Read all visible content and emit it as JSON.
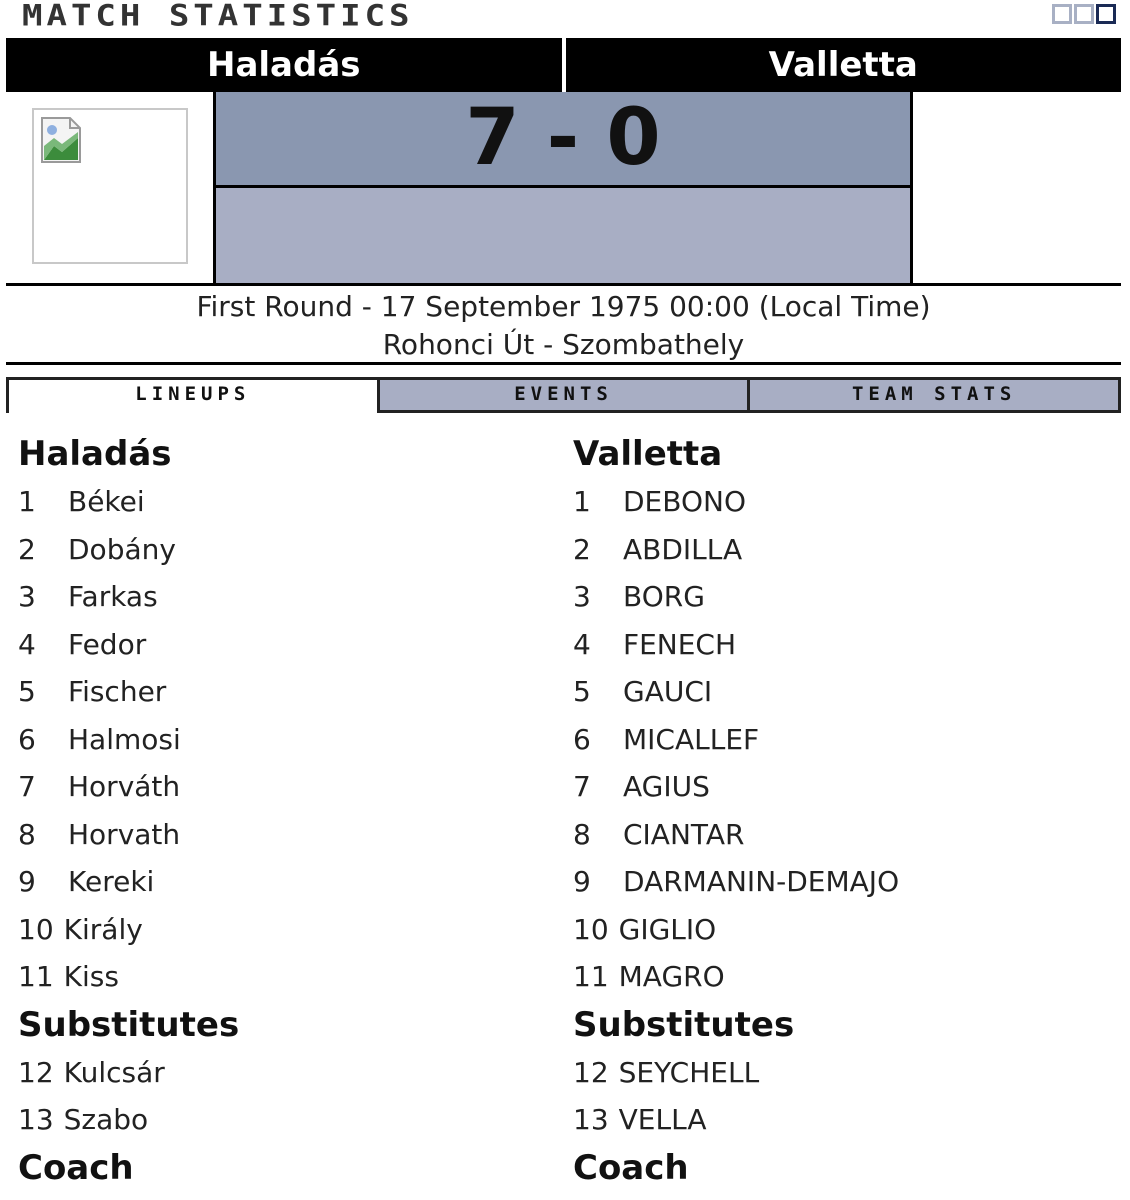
{
  "header": {
    "title": "MATCH STATISTICS"
  },
  "match": {
    "home_team": "Haladás",
    "away_team": "Valletta",
    "score": "7 - 0",
    "round_date": "First Round - 17 September 1975 00:00 (Local Time)",
    "venue": "Rohonci Út - Szombathely"
  },
  "tabs": [
    {
      "label": "LINEUPS",
      "active": true
    },
    {
      "label": "EVENTS",
      "active": false
    },
    {
      "label": "TEAM STATS",
      "active": false
    }
  ],
  "lineups": {
    "home": {
      "team": "Haladás",
      "players": [
        {
          "num": "1",
          "name": "Békei"
        },
        {
          "num": "2",
          "name": "Dobány"
        },
        {
          "num": "3",
          "name": "Farkas"
        },
        {
          "num": "4",
          "name": "Fedor"
        },
        {
          "num": "5",
          "name": "Fischer"
        },
        {
          "num": "6",
          "name": "Halmosi"
        },
        {
          "num": "7",
          "name": "Horváth"
        },
        {
          "num": "8",
          "name": "Horvath"
        },
        {
          "num": "9",
          "name": "Kereki"
        },
        {
          "num": "10",
          "name": "Király"
        },
        {
          "num": "11",
          "name": "Kiss"
        }
      ],
      "substitutes_label": "Substitutes",
      "substitutes": [
        {
          "num": "12",
          "name": "Kulcsár"
        },
        {
          "num": "13",
          "name": "Szabo"
        }
      ],
      "coach_label": "Coach"
    },
    "away": {
      "team": "Valletta",
      "players": [
        {
          "num": "1",
          "name": "DEBONO"
        },
        {
          "num": "2",
          "name": "ABDILLA"
        },
        {
          "num": "3",
          "name": "BORG"
        },
        {
          "num": "4",
          "name": "FENECH"
        },
        {
          "num": "5",
          "name": "GAUCI"
        },
        {
          "num": "6",
          "name": "MICALLEF"
        },
        {
          "num": "7",
          "name": "AGIUS"
        },
        {
          "num": "8",
          "name": "CIANTAR"
        },
        {
          "num": "9",
          "name": "DARMANIN-DEMAJO"
        },
        {
          "num": "10",
          "name": "GIGLIO"
        },
        {
          "num": "11",
          "name": "MAGRO"
        }
      ],
      "substitutes_label": "Substitutes",
      "substitutes": [
        {
          "num": "12",
          "name": "SEYCHELL"
        },
        {
          "num": "13",
          "name": "VELLA"
        }
      ],
      "coach_label": "Coach"
    }
  },
  "colors": {
    "score_top_bg": "#8a97b0",
    "score_bottom_bg": "#a8aec4",
    "tab_bg": "#a8aec4",
    "header_bg": "#000000"
  }
}
